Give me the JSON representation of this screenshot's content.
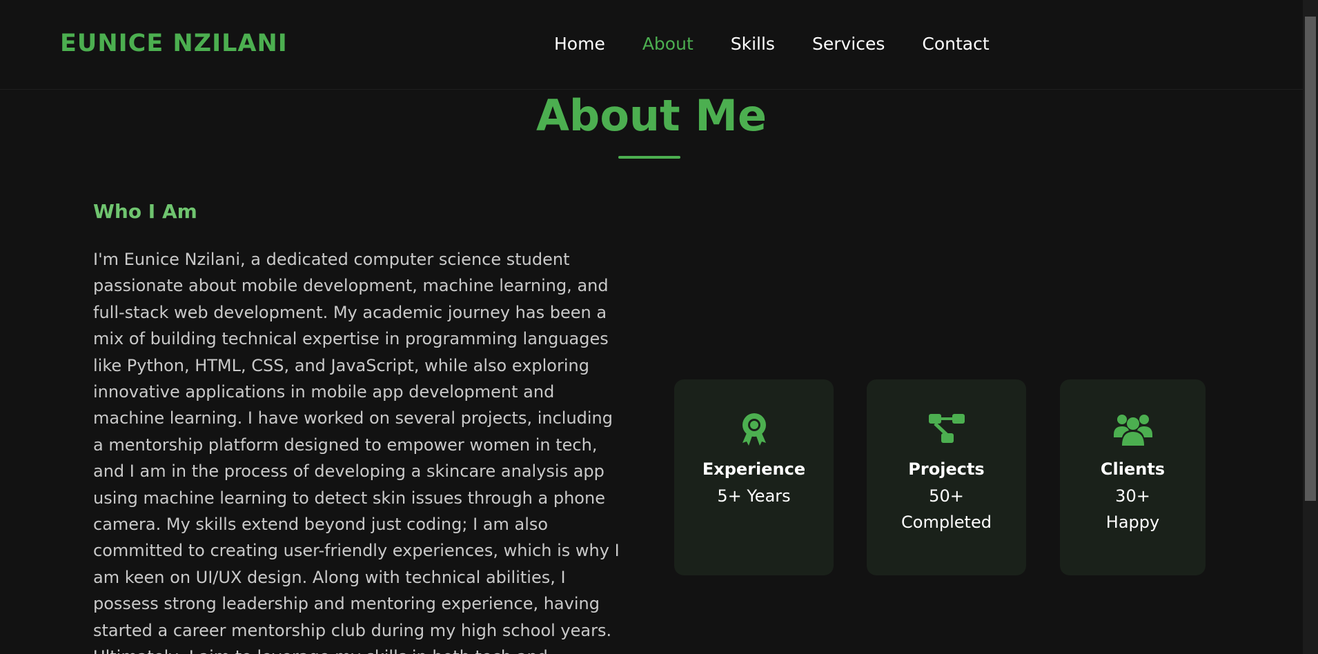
{
  "header": {
    "brand": "EUNICE NZILANI",
    "nav": [
      {
        "label": "Home"
      },
      {
        "label": "About"
      },
      {
        "label": "Skills"
      },
      {
        "label": "Services"
      },
      {
        "label": "Contact"
      }
    ],
    "active_nav": "About"
  },
  "about": {
    "title": "About Me",
    "who_heading": "Who I Am",
    "bio": "I'm Eunice Nzilani, a dedicated computer science student passionate about mobile development, machine learning, and full-stack web development. My academic journey has been a mix of building technical expertise in programming languages like Python, HTML, CSS, and JavaScript, while also exploring innovative applications in mobile app development and machine learning. I have worked on several projects, including a mentorship platform designed to empower women in tech, and I am in the process of developing a skincare analysis app using machine learning to detect skin issues through a phone camera. My skills extend beyond just coding; I am also committed to creating user-friendly experiences, which is why I am keen on UI/UX design. Along with technical abilities, I possess strong leadership and mentoring experience, having started a career mentorship club during my high school years. Ultimately, I aim to leverage my skills in both tech and",
    "stats": [
      {
        "label": "Experience",
        "value": "5+ Years",
        "icon": "award-icon"
      },
      {
        "label": "Projects",
        "value": "50+ Completed",
        "icon": "project-diagram-icon"
      },
      {
        "label": "Clients",
        "value": "30+ Happy",
        "icon": "users-icon"
      }
    ]
  },
  "colors": {
    "accent": "#4caf50",
    "background": "#121212",
    "card": "#1a211a",
    "text": "#c9c9c9"
  }
}
